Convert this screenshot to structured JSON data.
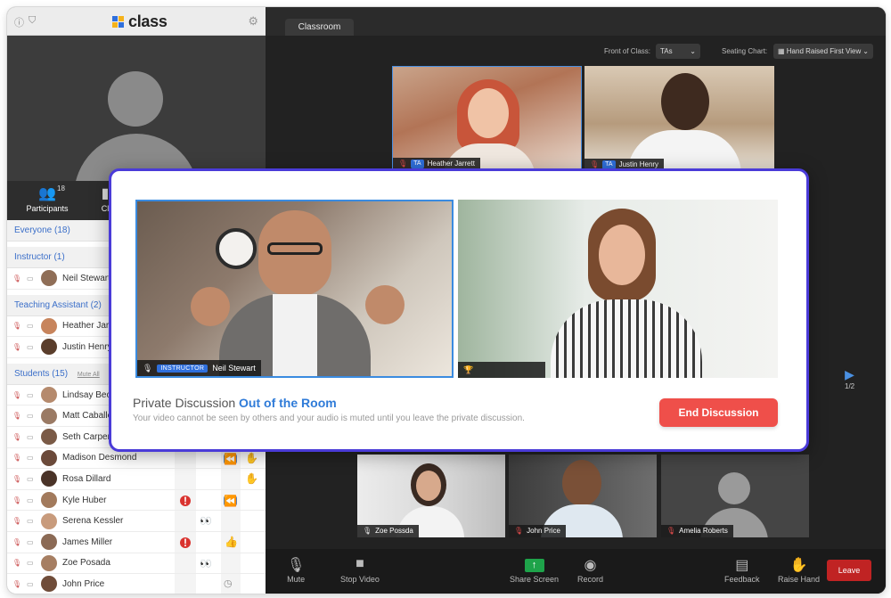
{
  "app": {
    "logo_text": "class",
    "colors": {
      "accent": "#2f6fdc",
      "modal_border": "#4a3bd8",
      "end_button": "#ef4f4a",
      "leave_button": "#c02323"
    }
  },
  "topbar": {
    "left_icons": [
      "info-icon",
      "shield-icon"
    ],
    "settings_icon": "gear-icon"
  },
  "participants_panel": {
    "tabs": [
      {
        "label": "Participants",
        "count": "18",
        "icon": "people-icon"
      },
      {
        "label": "Cl",
        "icon": "chat-icon"
      }
    ],
    "sections": {
      "everyone": "Everyone (18)",
      "instructor": "Instructor (1)",
      "ta": "Teaching Assistant (2)",
      "students": "Students (15)",
      "mute_all": "Mute All"
    },
    "instructor": [
      {
        "name": "Neil Stewart"
      }
    ],
    "tas": [
      {
        "name": "Heather Jarr"
      },
      {
        "name": "Justin Henry"
      }
    ],
    "students": [
      {
        "name": "Lindsay Beck"
      },
      {
        "name": "Matt Caballe"
      },
      {
        "name": "Seth Carpent"
      },
      {
        "name": "Madison Desmond",
        "badges": [
          "rewind-icon",
          "raised-hand-icon"
        ]
      },
      {
        "name": "Rosa Dillard",
        "badges": [
          "raised-hand-icon"
        ]
      },
      {
        "name": "Kyle Huber",
        "badges": [
          "alert-icon",
          "rewind-icon"
        ]
      },
      {
        "name": "Serena Kessler",
        "badges": [
          "eyes-icon"
        ]
      },
      {
        "name": "James Miller",
        "badges": [
          "alert-icon",
          "thumbs-up-icon"
        ]
      },
      {
        "name": "Zoe Posada",
        "badges": [
          "eyes-icon"
        ]
      },
      {
        "name": "John Price",
        "badges": [
          "clock-icon"
        ]
      }
    ]
  },
  "stage": {
    "tab": "Classroom",
    "front_of_class_label": "Front of Class:",
    "front_of_class_value": "TAs",
    "seating_chart_label": "Seating Chart:",
    "seating_chart_value": "Hand Raised First View",
    "front_tiles": [
      {
        "name": "Heather Jarrett",
        "role": "TA"
      },
      {
        "name": "Justin Henry",
        "role": "TA"
      }
    ],
    "bottom_tiles": [
      {
        "name": "Zoe Possda"
      },
      {
        "name": "John Price"
      },
      {
        "name": "Amelia Roberts"
      }
    ],
    "pager": "1/2"
  },
  "toolbar": {
    "mute": "Mute",
    "stop_video": "Stop Video",
    "share_screen": "Share Screen",
    "record": "Record",
    "feedback": "Feedback",
    "raise_hand": "Raise Hand",
    "leave": "Leave"
  },
  "modal": {
    "title_prefix": "Private Discussion",
    "title_status": "Out of the Room",
    "subtitle": "Your video cannot be seen by others and your audio is muted until you leave the private discussion.",
    "instructor_chip": "INSTRUCTOR",
    "instructor_name": "Neil Stewart",
    "end_button": "End Discussion"
  }
}
